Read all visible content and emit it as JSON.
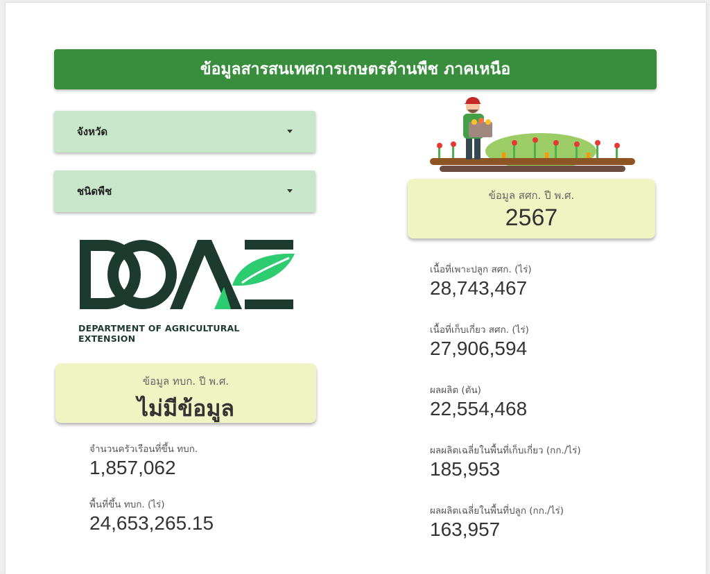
{
  "header": {
    "title": "ข้อมูลสารสนเทศการเกษตรด้านพืช ภาคเหนือ"
  },
  "filters": {
    "province_label": "จังหวัด",
    "crop_label": "ชนิดพืช"
  },
  "logo": {
    "letters": "DOAE",
    "caption": "DEPARTMENT OF AGRICULTURAL EXTENSION"
  },
  "farmer_registry": {
    "caption": "ข้อมูล ทบก. ปี พ.ศ.",
    "year_value": "ไม่มีข้อมูล",
    "stats": [
      {
        "label": "จำนวนครัวเรือนที่ขึ้น ทบก.",
        "value": "1,857,062"
      },
      {
        "label": "พื้นที่ขึ้น ทบก. (ไร่)",
        "value": "24,653,265.15"
      }
    ]
  },
  "crop_data": {
    "caption": "ข้อมูล สศก. ปี พ.ศ.",
    "year_value": "2567",
    "stats": [
      {
        "label": "เนื้อที่เพาะปลูก สศก. (ไร่)",
        "value": "28,743,467"
      },
      {
        "label": "เนื้อที่เก็บเกี่ยว สศก. (ไร่)",
        "value": "27,906,594"
      },
      {
        "label": "ผลผลิต (ตัน)",
        "value": "22,554,468"
      },
      {
        "label": "ผลผลิตเฉลี่ยในพื้นที่เก็บเกี่ยว (กก./ไร่)",
        "value": "185,953"
      },
      {
        "label": "ผลผลิตเฉลี่ยในพื้นที่ปลูก (กก./ไร่)",
        "value": "163,957"
      }
    ]
  },
  "colors": {
    "header_bg": "#388e3c",
    "dropdown_bg": "#c8e6c9",
    "card_bg": "#f0f4c3",
    "logo_dark": "#1d3a2f",
    "logo_green": "#2ecc71"
  }
}
